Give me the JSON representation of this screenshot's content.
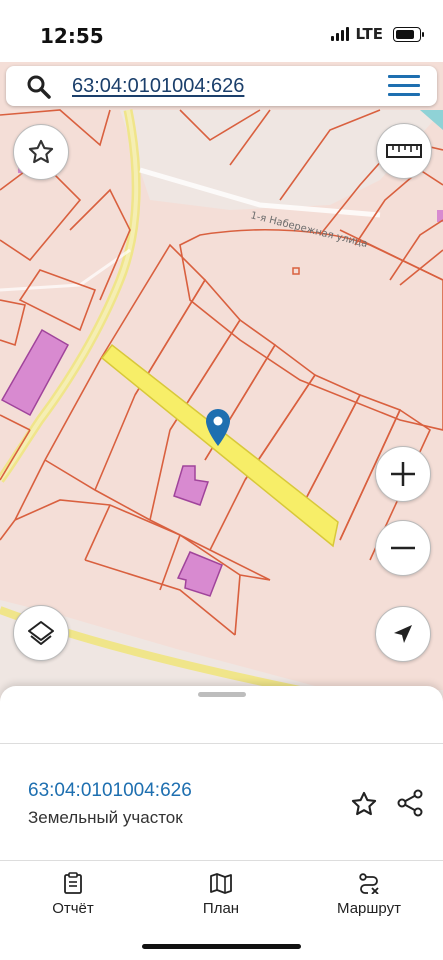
{
  "status_bar": {
    "time": "12:55",
    "network": "LTE"
  },
  "search": {
    "query": "63:04:0101004:626"
  },
  "map": {
    "street_label": "1-я Набережная улица"
  },
  "parcel": {
    "id": "63:04:0101004:626",
    "type": "Земельный участок"
  },
  "tabs": [
    {
      "label": "Отчёт",
      "icon": "report-icon"
    },
    {
      "label": "План",
      "icon": "map-plan-icon"
    },
    {
      "label": "Маршрут",
      "icon": "route-icon"
    }
  ],
  "colors": {
    "accent": "#1e6fb0",
    "parcel_fill": "#f4ded7",
    "parcel_line": "#d9603f",
    "selected": "#f7ee68",
    "building": "#d88ad0",
    "road": "#f0e58a"
  }
}
